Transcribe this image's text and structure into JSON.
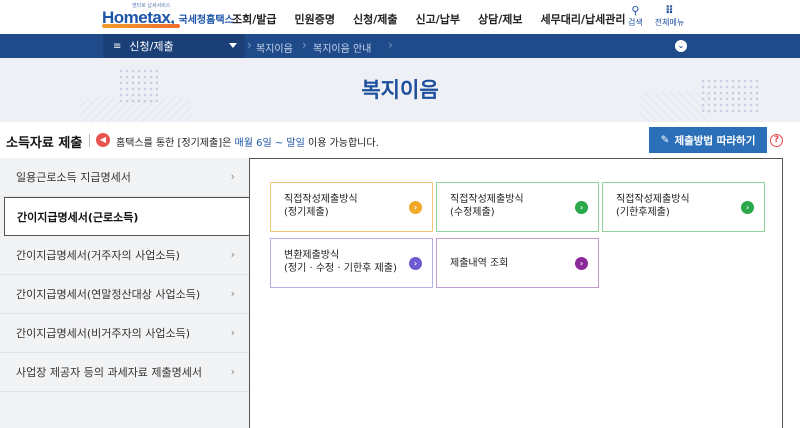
{
  "header": {
    "logo_text": "Hometax,",
    "logo_sub": "국세청홈택스",
    "logo_tiny": "엔터로 납세서비스",
    "nav": [
      "조회/발급",
      "민원증명",
      "신청/제출",
      "신고/납부",
      "상담/제보",
      "세무대리/납세관리"
    ],
    "tools": [
      {
        "icon": "search-icon",
        "glyph": "🔍",
        "label": "검색"
      },
      {
        "icon": "grid-menu-icon",
        "glyph": "⋮⋮",
        "label": "전체메뉴"
      }
    ]
  },
  "breadcrumb": {
    "menu_label": "신청/제출",
    "items": [
      "복지이음",
      "복지이음 안내"
    ],
    "colors": {
      "bar": "#1f4b8a",
      "segment": "#1b3f77"
    }
  },
  "hero": {
    "title": "복지이음"
  },
  "notice": {
    "section_title": "소득자료 제출",
    "msg_prefix": "홈택스를 통한 [정기제출]은 ",
    "msg_highlight": "매월 6일 ~ 말일",
    "msg_suffix": " 이용 가능합니다.",
    "guide_button": "제출방법 따라하기",
    "help_glyph": "?"
  },
  "side_menu": [
    {
      "label": "일용근로소득 지급명세서",
      "active": false
    },
    {
      "label": "간이지급명세서(근로소득)",
      "active": true
    },
    {
      "label": "간이지급명세서(거주자의 사업소득)",
      "active": false
    },
    {
      "label": "간이지급명세서(연말정산대상 사업소득)",
      "active": false
    },
    {
      "label": "간이지급명세서(비거주자의 사업소득)",
      "active": false
    },
    {
      "label": "사업장 제공자 등의 과세자료 제출명세서",
      "active": false
    }
  ],
  "cards": [
    {
      "line1": "직접작성제출방식",
      "line2": "(정기제출)",
      "accent": "#f0a928"
    },
    {
      "line1": "직접작성제출방식",
      "line2": "(수정제출)",
      "accent": "#2aa84a"
    },
    {
      "line1": "직접작성제출방식",
      "line2": "(기한후제출)",
      "accent": "#2aa84a"
    },
    {
      "line1": "변환제출방식",
      "line2": "(정기 · 수정 · 기한후 제출)",
      "accent": "#6c5bd0"
    },
    {
      "line1": "제출내역 조회",
      "line2": "",
      "accent": "#8a2a9a"
    }
  ]
}
